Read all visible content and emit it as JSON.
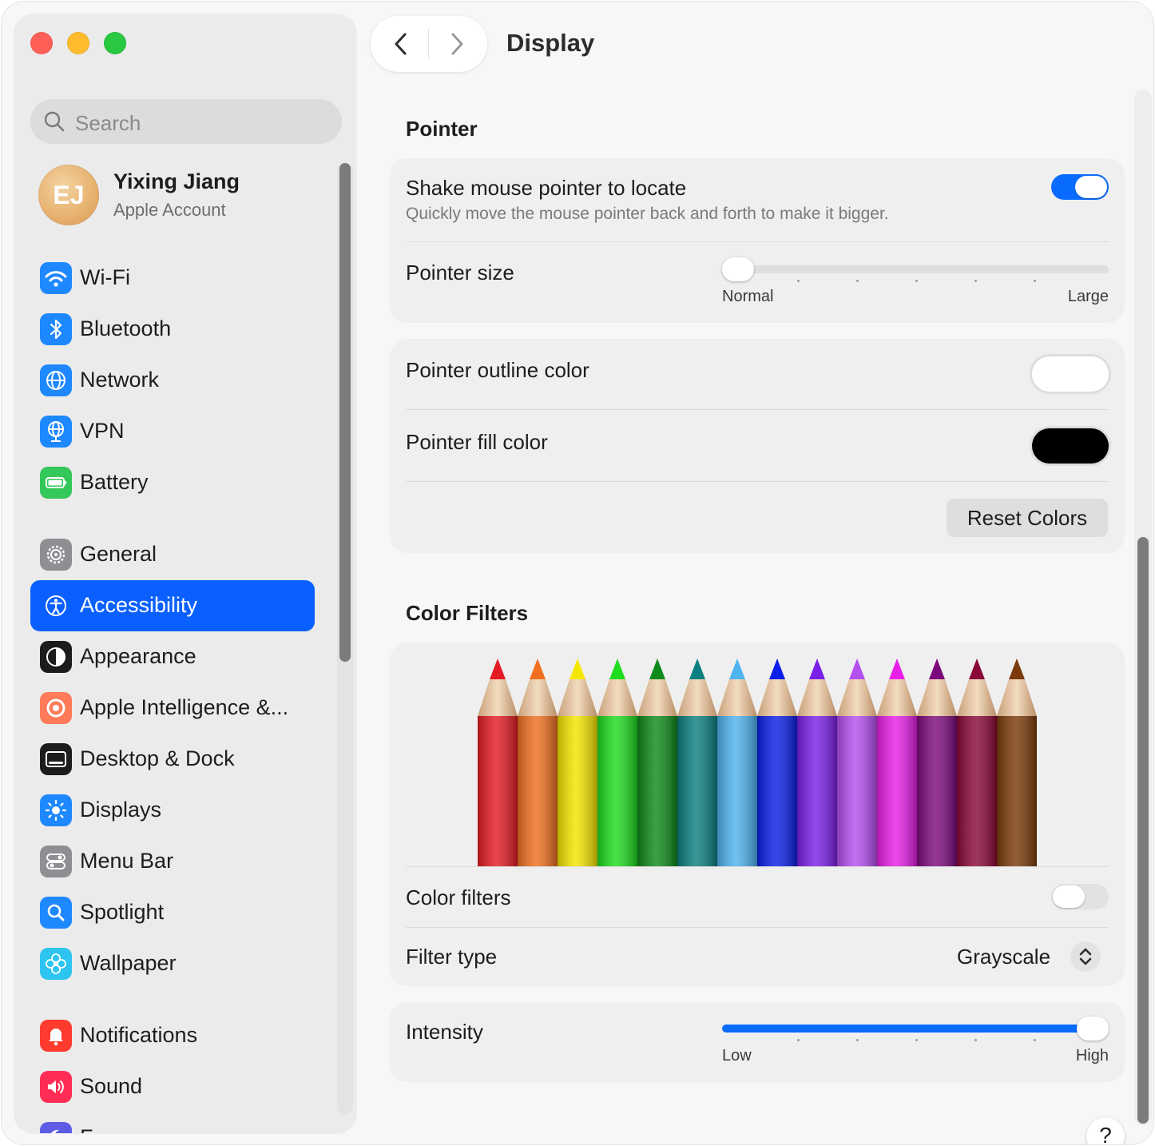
{
  "window": {
    "title": "Display",
    "accent_color": "#0a60ff"
  },
  "sidebar": {
    "search": {
      "placeholder": "Search"
    },
    "account": {
      "initials": "EJ",
      "name": "Yixing Jiang",
      "subtitle": "Apple Account"
    },
    "items": [
      {
        "label": "Wi-Fi",
        "icon": "wifi-icon",
        "color": "#1e88ff"
      },
      {
        "label": "Bluetooth",
        "icon": "bluetooth-icon",
        "color": "#1e88ff"
      },
      {
        "label": "Network",
        "icon": "globe-icon",
        "color": "#1e88ff"
      },
      {
        "label": "VPN",
        "icon": "vpn-globe-icon",
        "color": "#1e88ff"
      },
      {
        "label": "Battery",
        "icon": "battery-icon",
        "color": "#34c759"
      },
      {
        "label": "General",
        "icon": "gear-icon",
        "color": "#8e8e93"
      },
      {
        "label": "Accessibility",
        "icon": "accessibility-icon",
        "color": "#1e88ff",
        "active": true
      },
      {
        "label": "Appearance",
        "icon": "appearance-icon",
        "color": "#1c1c1e"
      },
      {
        "label": "Apple Intelligence &...",
        "icon": "apple-intelligence-icon",
        "color": "#ff7a59"
      },
      {
        "label": "Desktop & Dock",
        "icon": "dock-icon",
        "color": "#1c1c1e"
      },
      {
        "label": "Displays",
        "icon": "sun-icon",
        "color": "#1e88ff"
      },
      {
        "label": "Menu Bar",
        "icon": "menu-bar-icon",
        "color": "#8e8e93"
      },
      {
        "label": "Spotlight",
        "icon": "magnifier-icon",
        "color": "#1e88ff"
      },
      {
        "label": "Wallpaper",
        "icon": "flower-icon",
        "color": "#2ec4f0"
      },
      {
        "label": "Notifications",
        "icon": "bell-icon",
        "color": "#ff3b30"
      },
      {
        "label": "Sound",
        "icon": "speaker-icon",
        "color": "#ff2d55"
      },
      {
        "label": "F",
        "icon": "focus-icon",
        "color": "#5e5ce6"
      }
    ]
  },
  "pointer": {
    "section_title": "Pointer",
    "shake": {
      "label": "Shake mouse pointer to locate",
      "description": "Quickly move the mouse pointer back and forth to make it bigger.",
      "enabled": true
    },
    "size": {
      "label": "Pointer size",
      "min_label": "Normal",
      "max_label": "Large",
      "value": 0
    },
    "outline_color": {
      "label": "Pointer outline color",
      "color": "#ffffff"
    },
    "fill_color": {
      "label": "Pointer fill color",
      "color": "#000000"
    },
    "reset_button": "Reset Colors"
  },
  "color_filters": {
    "section_title": "Color Filters",
    "pencil_colors": [
      "#e31b23",
      "#f07020",
      "#f5e600",
      "#1fdc1f",
      "#0e8a1a",
      "#0b7f7f",
      "#4fb3ef",
      "#0b1fe8",
      "#7a1fe8",
      "#b44ff0",
      "#e81fe8",
      "#7d0a7d",
      "#8a0838",
      "#7a3a0a"
    ],
    "toggle_label": "Color filters",
    "enabled": false,
    "filter_type_label": "Filter type",
    "filter_type_value": "Grayscale",
    "intensity": {
      "label": "Intensity",
      "min_label": "Low",
      "max_label": "High",
      "value": 1.0
    }
  },
  "help_button": "?"
}
